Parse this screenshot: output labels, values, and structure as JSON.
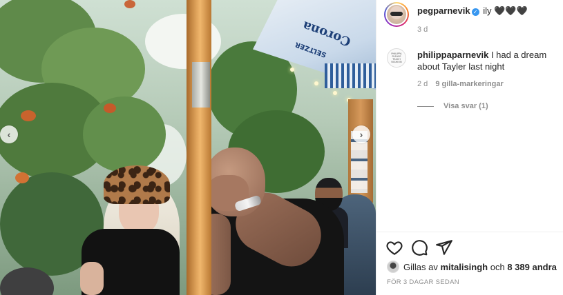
{
  "post": {
    "username": "pegparnevik",
    "verified_glyph": "✓",
    "caption_text": "ily 🖤🖤🖤",
    "time": "3 d"
  },
  "umbrella": {
    "brand": "Corona",
    "sub": "SELTZER"
  },
  "comment": {
    "username": "philippaparnevik",
    "text": "I had a dream about Tayler last night",
    "time": "2 d",
    "likes": "9 gilla-markeringar",
    "view_replies": "Visa svar (1)",
    "avatar_lines": [
      "PHILIPPA",
      "PLEASE",
      "TEACH",
      "FASHION"
    ]
  },
  "actions": {
    "like": "heart-icon",
    "comment": "comment-icon",
    "share": "share-icon"
  },
  "likes_row": {
    "prefix": "Gillas av",
    "user": "mitalisingh",
    "conj": "och",
    "others": "8 389 andra"
  },
  "post_time": "FÖR 3 DAGAR SEDAN",
  "nav": {
    "prev": "‹",
    "next": "›"
  },
  "colors": {
    "verified": "#3897f0",
    "meta_gray": "#8e8e8e",
    "text": "#262626"
  }
}
